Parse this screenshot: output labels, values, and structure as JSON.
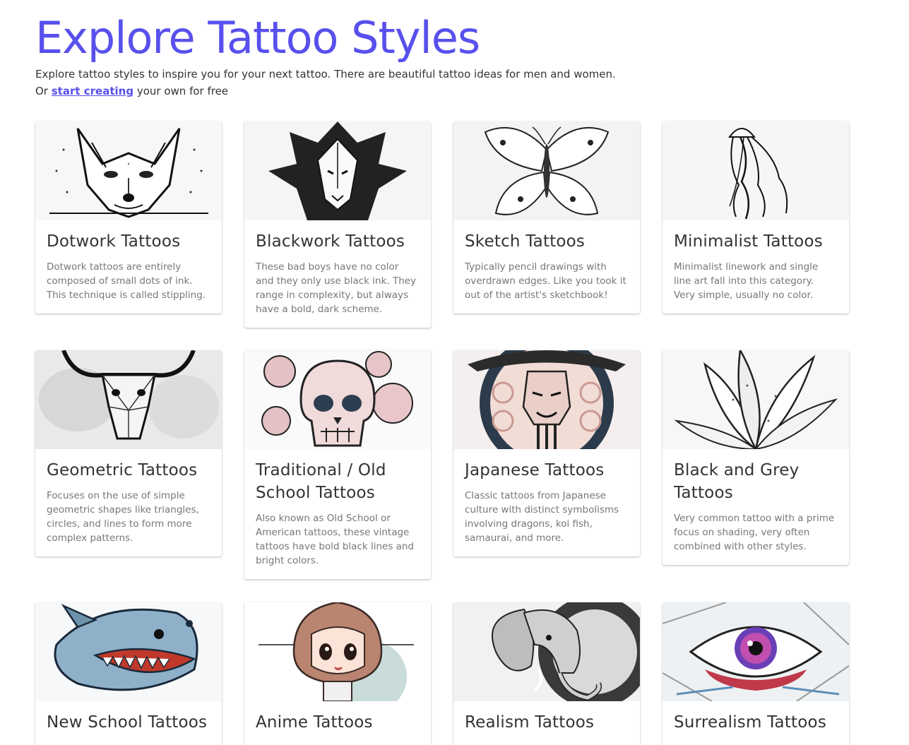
{
  "header": {
    "title": "Explore Tattoo Styles",
    "intro_line1": "Explore tattoo styles to inspire you for your next tattoo. There are beautiful tattoo ideas for men and women.",
    "intro_or": "Or ",
    "intro_link": "start creating",
    "intro_rest": " your own for free"
  },
  "colors": {
    "accent": "#5850ec",
    "text": "#333333",
    "muted": "#777777"
  },
  "cards": [
    {
      "title": "Dotwork Tattoos",
      "desc": "Dotwork tattoos are entirely composed of small dots of ink. This technique is called stippling.",
      "image": "fox-dotwork-image"
    },
    {
      "title": "Blackwork Tattoos",
      "desc": "These bad boys have no color and they only use black ink. They range in complexity, but always have a bold, dark scheme.",
      "image": "lion-blackwork-image"
    },
    {
      "title": "Sketch Tattoos",
      "desc": "Typically pencil drawings with overdrawn edges. Like you took it out of the artist's sketchbook!",
      "image": "butterfly-sketch-image"
    },
    {
      "title": "Minimalist Tattoos",
      "desc": "Minimalist linework and single line art fall into this category. Very simple, usually no color.",
      "image": "jellyfish-minimalist-image"
    },
    {
      "title": "Geometric Tattoos",
      "desc": "Focuses on the use of simple geometric shapes like triangles, circles, and lines to form more complex patterns.",
      "image": "bull-skull-geometric-image"
    },
    {
      "title": "Traditional / Old School Tattoos",
      "desc": "Also known as Old School or American tattoos, these vintage tattoos have bold black lines and bright colors.",
      "image": "skull-roses-traditional-image"
    },
    {
      "title": "Japanese Tattoos",
      "desc": "Classic tattoos from Japanese culture with distinct symbolisms involving dragons, koi fish, samaurai, and more.",
      "image": "samurai-japanese-image"
    },
    {
      "title": "Black and Grey Tattoos",
      "desc": "Very common tattoo with a prime focus on shading, very often combined with other styles.",
      "image": "flower-black-grey-image"
    },
    {
      "title": "New School Tattoos",
      "desc": "",
      "image": "shark-new-school-image"
    },
    {
      "title": "Anime Tattoos",
      "desc": "",
      "image": "anime-girl-image"
    },
    {
      "title": "Realism Tattoos",
      "desc": "",
      "image": "elephant-realism-image"
    },
    {
      "title": "Surrealism Tattoos",
      "desc": "",
      "image": "eye-surrealism-image"
    }
  ]
}
